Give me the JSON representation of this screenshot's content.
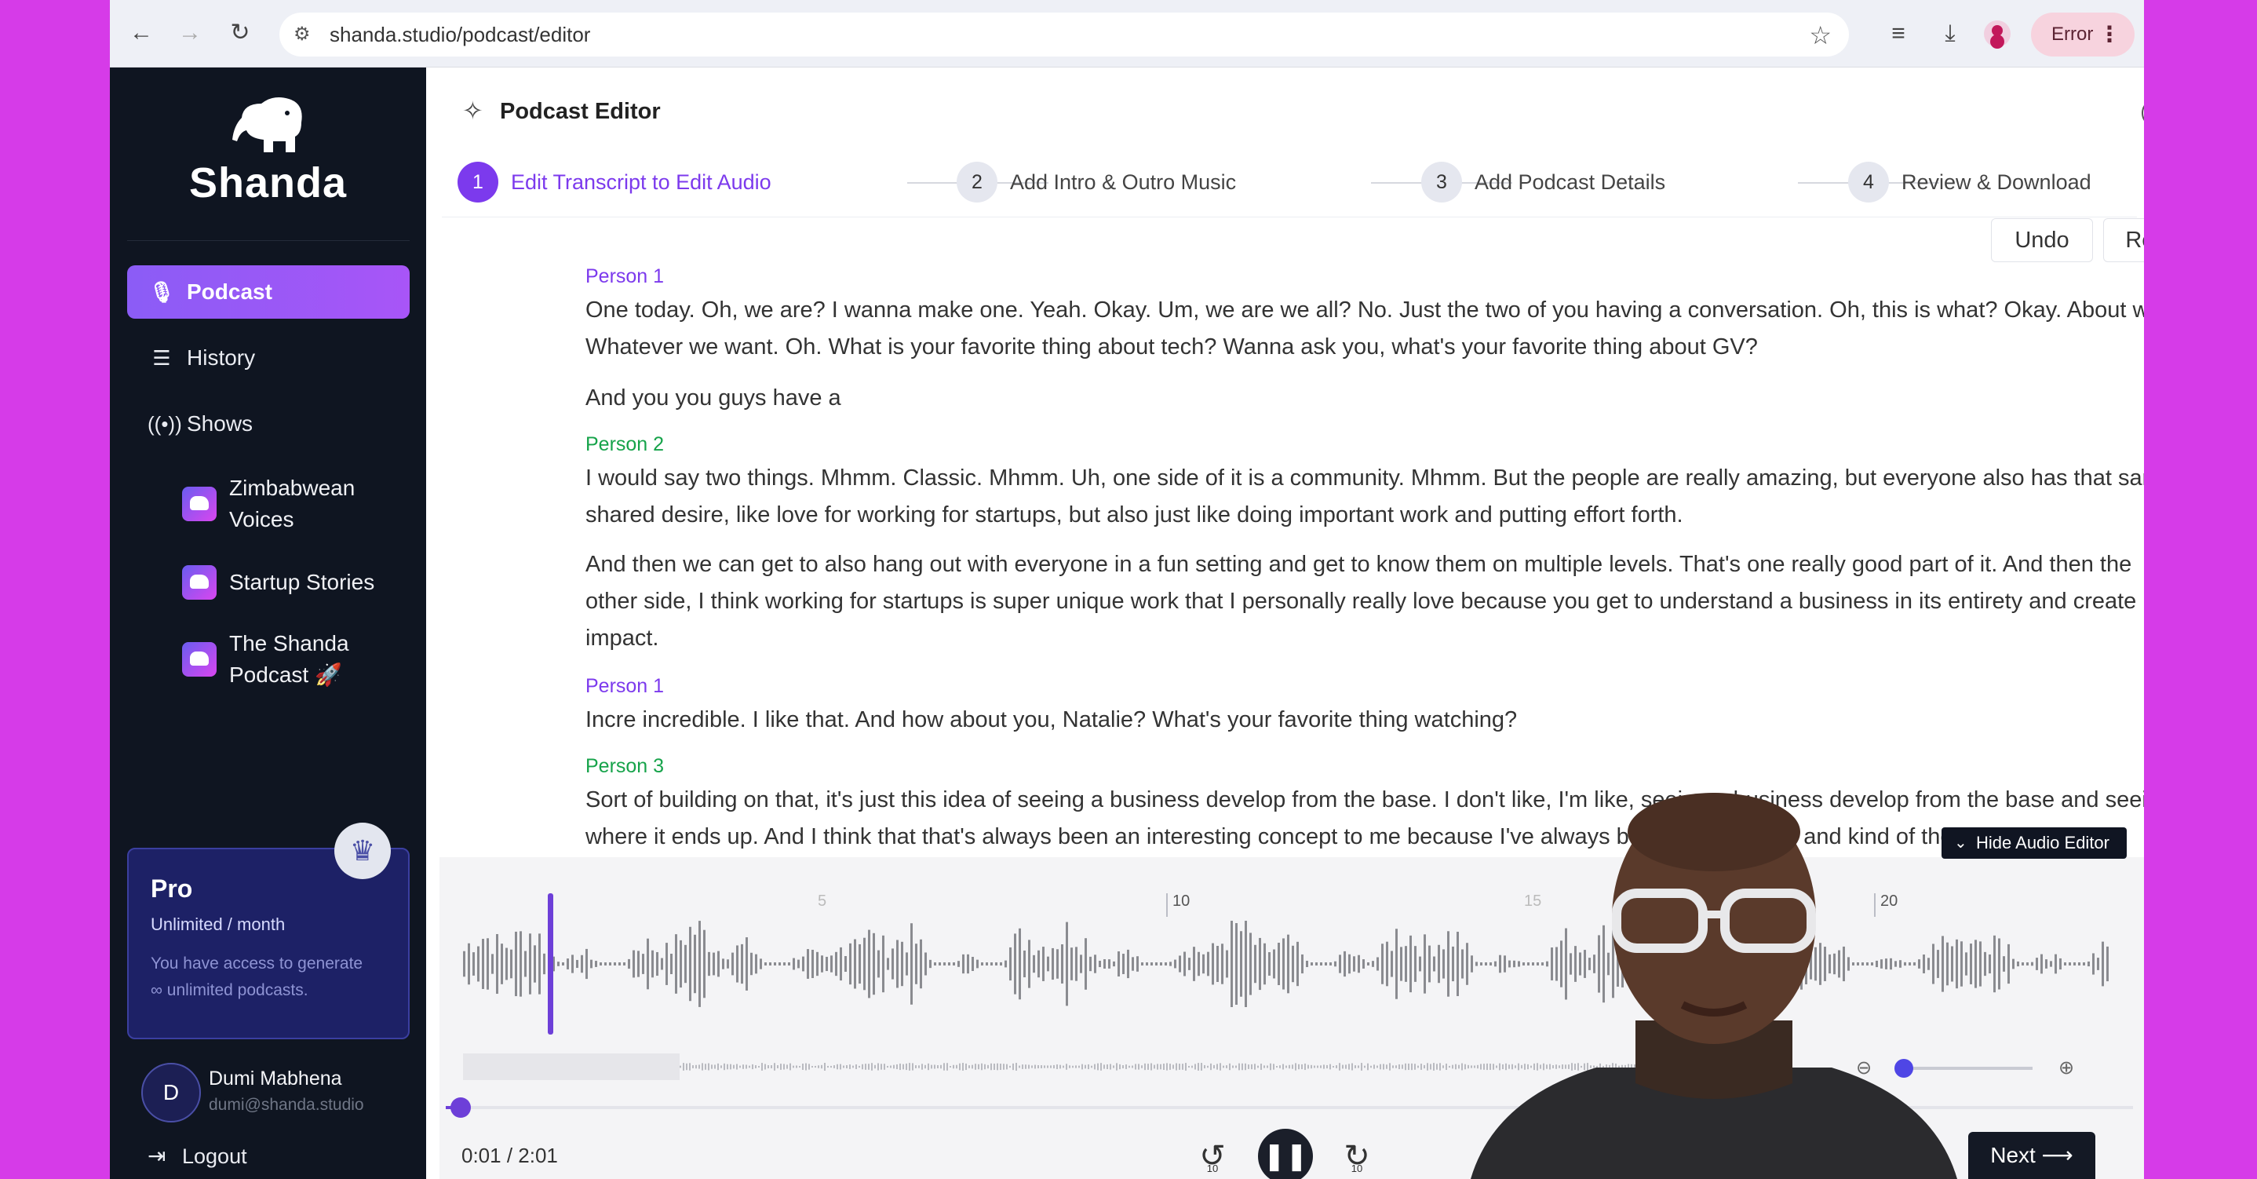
{
  "browser": {
    "url": "shanda.studio/podcast/editor",
    "error_label": "Error"
  },
  "sidebar": {
    "logo_text": "Shanda",
    "nav": [
      {
        "label": "Podcast",
        "icon": "microphone-icon",
        "active": true
      },
      {
        "label": "History",
        "icon": "list-icon",
        "active": false
      },
      {
        "label": "Shows",
        "icon": "broadcast-icon",
        "active": false
      }
    ],
    "shows": [
      {
        "line1": "Zimbabwean",
        "line2": "Voices"
      },
      {
        "line1": "Startup Stories",
        "line2": ""
      },
      {
        "line1": "The Shanda",
        "line2": "Podcast 🚀"
      }
    ],
    "pro": {
      "title": "Pro",
      "subtitle": "Unlimited / month",
      "description_line1": "You have access to generate",
      "description_line2": "∞ unlimited podcasts."
    },
    "user": {
      "initial": "D",
      "name": "Dumi Mabhena",
      "email": "dumi@shanda.studio"
    },
    "logout_label": "Logout"
  },
  "editor": {
    "title": "Podcast Editor",
    "steps": [
      {
        "num": "1",
        "label": "Edit Transcript to Edit Audio",
        "active": true
      },
      {
        "num": "2",
        "label": "Add Intro & Outro Music",
        "active": false
      },
      {
        "num": "3",
        "label": "Add Podcast Details",
        "active": false
      },
      {
        "num": "4",
        "label": "Review & Download",
        "active": false
      }
    ],
    "undo_label": "Undo",
    "redo_label": "Redo"
  },
  "transcript": [
    {
      "speaker": "Person 1",
      "line1": "One today. Oh, we are? I wanna make one. Yeah. Okay. Um, we are we all? No. Just the two of you having a conversation. Oh, this is what? Okay. About what?",
      "line2": "Whatever we want. Oh. What is your favorite thing about tech? Wanna ask you, what's your favorite thing about GV?"
    },
    {
      "speaker": "",
      "line1": "And you you guys have a"
    },
    {
      "speaker": "Person 2",
      "line1": "I would say two things. Mhmm. Classic. Mhmm. Uh, one side of it is a community. Mhmm. But the people are really amazing, but everyone also has that same",
      "line2": "shared desire, like love for working for startups, but also just like doing important work and putting effort forth."
    },
    {
      "speaker": "",
      "line1": "And then we can get to also hang out with everyone in a fun setting and get to know them on multiple levels. That's one really good part of it. And then the",
      "line2": "other side, I think working for startups is super unique work that I personally really love because you get to understand a business in its entirety and create",
      "line3": "impact."
    },
    {
      "speaker": "Person 1",
      "line1": "Incre incredible. I like that. And how about you, Natalie? What's your favorite thing watching?"
    },
    {
      "speaker": "Person 3",
      "line1": "Sort of building on that, it's just this idea of seeing a business develop from the base. I don't like, I'm like, seeing a business develop from the base and seeing",
      "line2": "where it ends up. And I think that that's always been an interesting concept to me because I've always been interested in and kind of the"
    }
  ],
  "audio": {
    "hide_label": "Hide Audio Editor",
    "ruler_labels": [
      "5",
      "10",
      "15",
      "20"
    ],
    "time_display": "0:01 / 2:01",
    "progress_fraction": 0.008,
    "next_label": "Next ⟶"
  },
  "colors": {
    "accent": "#7c3aed",
    "sidebar_bg": "#0f1521",
    "page_bg": "#d63be8",
    "speaker_alt": "#16a34a"
  }
}
